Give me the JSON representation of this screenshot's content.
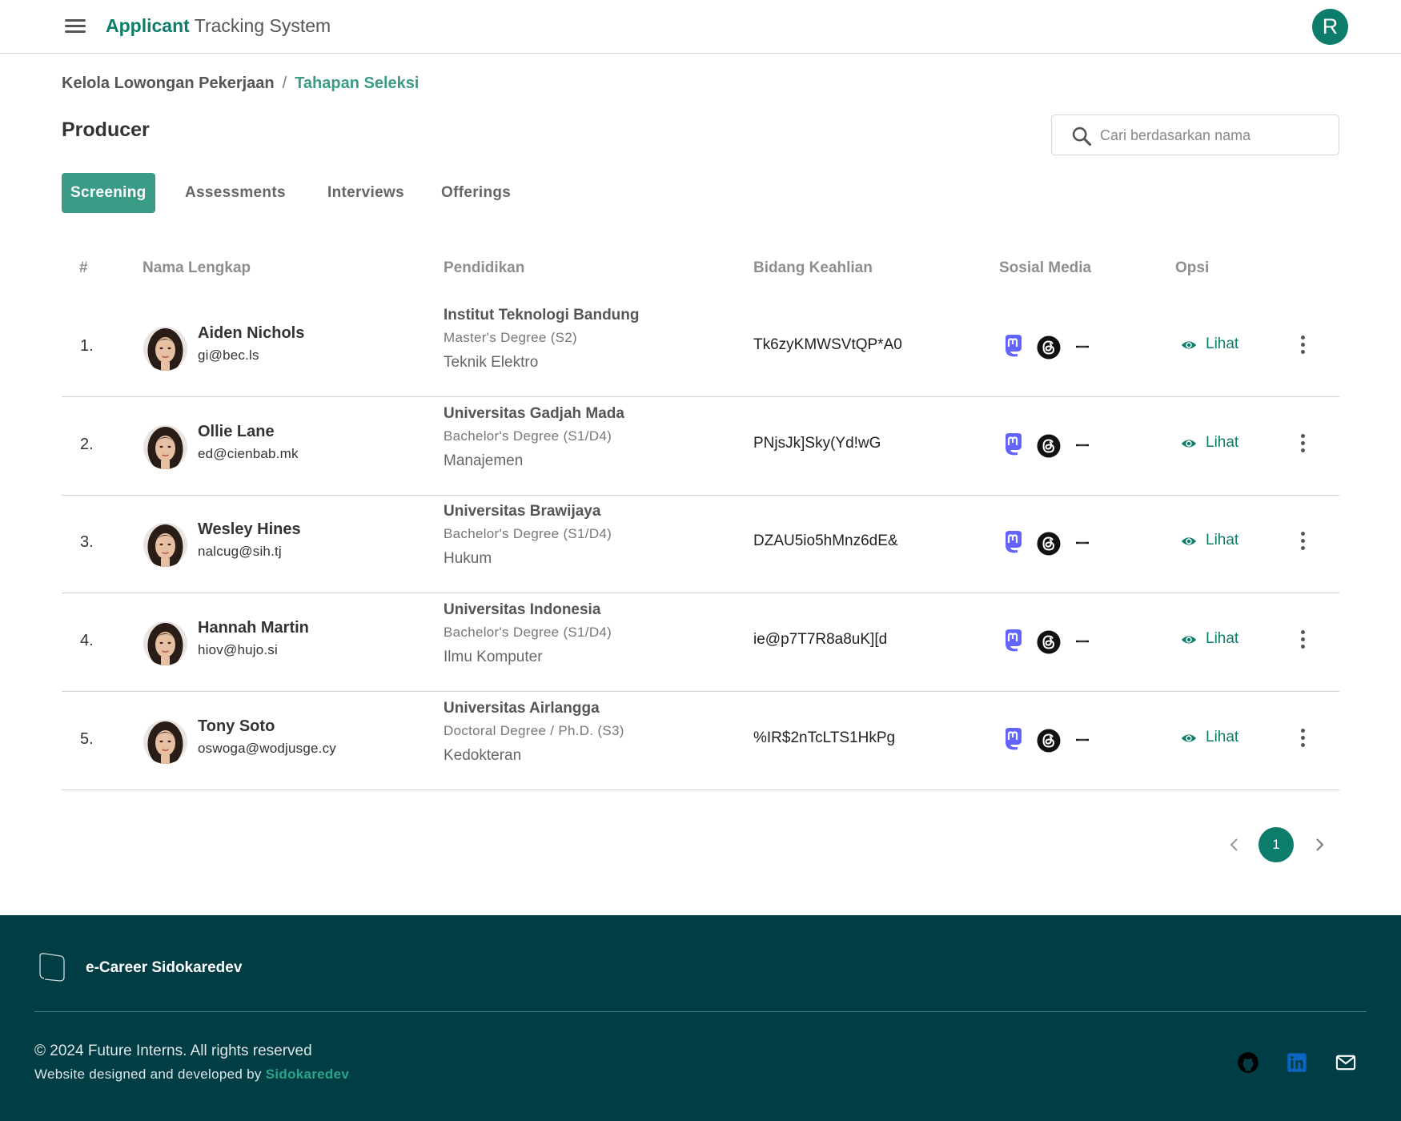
{
  "header": {
    "title_strong": "Applicant",
    "title_rest": "Tracking System",
    "user_initial": "R"
  },
  "breadcrumb": {
    "items": [
      "Kelola Lowongan Pekerjaan",
      "Tahapan Seleksi"
    ],
    "separator": "/"
  },
  "page": {
    "title": "Producer"
  },
  "search": {
    "placeholder": "Cari berdasarkan nama",
    "value": ""
  },
  "tabs": [
    {
      "label": "Screening",
      "active": true
    },
    {
      "label": "Assessments",
      "active": false
    },
    {
      "label": "Interviews",
      "active": false
    },
    {
      "label": "Offerings",
      "active": false
    }
  ],
  "table": {
    "headers": [
      "#",
      "Nama Lengkap",
      "Pendidikan",
      "Bidang Keahlian",
      "Sosial Media",
      "Opsi"
    ],
    "view_label": "Lihat",
    "rows": [
      {
        "no": "1.",
        "name": "Aiden Nichols",
        "email": "gi@bec.ls",
        "university": "Institut Teknologi Bandung",
        "degree": "Master's Degree (S2)",
        "major": "Teknik Elektro",
        "skill": "Tk6zyKMWSVtQP*A0",
        "socials": [
          "mastodon-icon",
          "threads-icon",
          "link-icon"
        ]
      },
      {
        "no": "2.",
        "name": "Ollie Lane",
        "email": "ed@cienbab.mk",
        "university": "Universitas Gadjah Mada",
        "degree": "Bachelor's Degree (S1/D4)",
        "major": "Manajemen",
        "skill": "PNjsJk]Sky(Yd!wG",
        "socials": [
          "mastodon-icon",
          "threads-icon",
          "link-icon"
        ]
      },
      {
        "no": "3.",
        "name": "Wesley Hines",
        "email": "nalcug@sih.tj",
        "university": "Universitas Brawijaya",
        "degree": "Bachelor's Degree (S1/D4)",
        "major": "Hukum",
        "skill": "DZAU5io5hMnz6dE&",
        "socials": [
          "mastodon-icon",
          "threads-icon",
          "link-icon"
        ]
      },
      {
        "no": "4.",
        "name": "Hannah Martin",
        "email": "hiov@hujo.si",
        "university": "Universitas Indonesia",
        "degree": "Bachelor's Degree (S1/D4)",
        "major": "Ilmu Komputer",
        "skill": "ie@p7T7R8a8uK][d",
        "socials": [
          "mastodon-icon",
          "threads-icon",
          "link-icon"
        ]
      },
      {
        "no": "5.",
        "name": "Tony Soto",
        "email": "oswoga@wodjusge.cy",
        "university": "Universitas Airlangga",
        "degree": "Doctoral Degree / Ph.D. (S3)",
        "major": "Kedokteran",
        "skill": "%IR$2nTcLTS1HkPg",
        "socials": [
          "mastodon-icon",
          "threads-icon",
          "link-icon"
        ]
      }
    ]
  },
  "pagination": {
    "current_page": "1"
  },
  "footer": {
    "brand": "e-Career Sidokaredev",
    "copyright": "© 2024 Future Interns. All rights reserved",
    "dev_prefix": "Website designed and developed by",
    "dev_name": "Sidokaredev",
    "icons": [
      "github-icon",
      "linkedin-icon",
      "mail-icon"
    ]
  },
  "colors": {
    "primary": "#0c7d6a",
    "tab_active": "#3a9c86",
    "footer_bg": "#003d45",
    "mastodon": "#6364ff",
    "linkedin": "#0a66c2"
  }
}
